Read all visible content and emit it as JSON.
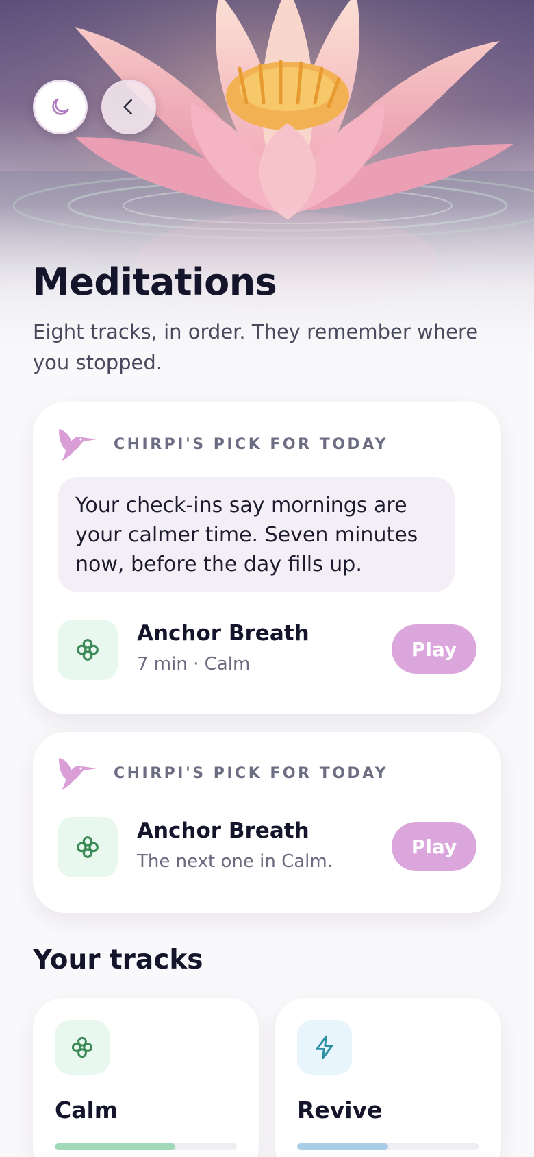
{
  "header": {
    "theme_toggle_icon": "moon-icon",
    "back_icon": "chevron-left-icon"
  },
  "page": {
    "title": "Meditations",
    "subtitle": "Eight tracks, in order. They remember where you stopped."
  },
  "pick_card_primary": {
    "label": "CHIRPI'S PICK FOR TODAY",
    "mascot_icon": "hummingbird-icon",
    "message": "Your check-ins say mornings are your calmer time. Seven minutes now, before the day fills up.",
    "track": {
      "name": "Anchor Breath",
      "meta": "7 min · Calm",
      "icon": "clover-icon",
      "play_label": "Play"
    }
  },
  "pick_card_secondary": {
    "label": "CHIRPI'S PICK FOR TODAY",
    "mascot_icon": "hummingbird-icon",
    "track": {
      "name": "Anchor Breath",
      "meta": "The next one in Calm.",
      "icon": "clover-icon",
      "play_label": "Play"
    }
  },
  "tracks_section": {
    "title": "Your tracks",
    "tracks": [
      {
        "name": "Calm",
        "icon": "clover-icon",
        "progress": 0.66,
        "color": "#9fd9b8",
        "icon_bg": "#e9f8ef"
      },
      {
        "name": "Revive",
        "icon": "lightning-icon",
        "progress": 0.5,
        "color": "#a9cde6",
        "icon_bg": "#e8f5fc"
      }
    ]
  },
  "colors": {
    "accent": "#dba6dc",
    "bubble": "#f4eef6",
    "title": "#14152b"
  }
}
